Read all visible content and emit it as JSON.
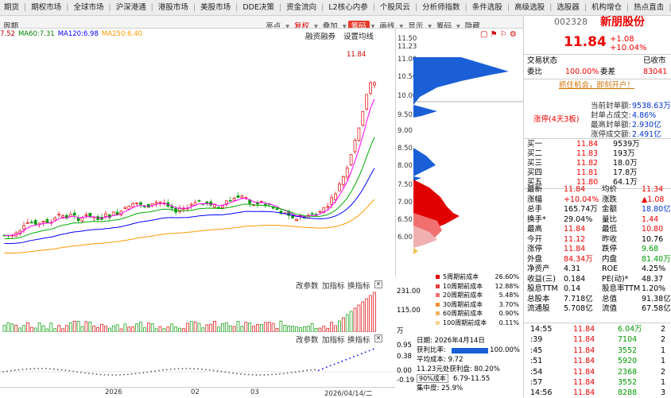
{
  "menubar": [
    "期货",
    "期权市场",
    "全球市场",
    "沪深港通",
    "港股市场",
    "美股市场",
    "DDE决策",
    "资金流向",
    "L2核心内参",
    "个股风云",
    "分析师指数",
    "条件选股",
    "高级选股",
    "选股器",
    "机构增仓",
    "热点直击",
    "高成长性"
  ],
  "toolbar": {
    "period": "周期",
    "tools": [
      "亮点",
      "复权",
      "叠加",
      "筹码",
      "画线",
      "显示",
      "筹码",
      "隐藏"
    ],
    "active": "筹码"
  },
  "ma_legend": [
    {
      "label": "7.52",
      "color": "#c00000"
    },
    {
      "label": "MA60:7.31",
      "color": "#008000"
    },
    {
      "label": "MA120:6.98",
      "color": "#0000ff"
    },
    {
      "label": "MA250:6.40",
      "color": "#ff9900"
    }
  ],
  "chart_tools": {
    "rzrq": "融资融券",
    "setma": "设置均线"
  },
  "price_marker": "11.84",
  "price_axis": [
    "11.50",
    "11.23",
    "11.00",
    "10.50",
    "10.00",
    "9.50",
    "9.00",
    "8.50",
    "8.00",
    "7.50",
    "7.00",
    "6.50",
    "6.00"
  ],
  "cost_legend": [
    {
      "label": "5周期前成本",
      "pct": "26.60%",
      "color": "#e00000"
    },
    {
      "label": "10周期前成本",
      "pct": "12.88%",
      "color": "#e84040"
    },
    {
      "label": "20周期前成本",
      "pct": "5.48%",
      "color": "#f07070"
    },
    {
      "label": "30周期前成本",
      "pct": "3.70%",
      "color": "#f09030"
    },
    {
      "label": "60周期前成本",
      "pct": "0.90%",
      "color": "#f0b060"
    },
    {
      "label": "100周期前成本",
      "pct": "0.11%",
      "color": "#f8d090"
    }
  ],
  "sub1": {
    "tools": [
      "改参数",
      "加指标",
      "换指标"
    ],
    "axis": [
      "231.00",
      "115.00",
      "万"
    ]
  },
  "sub2": {
    "tools": [
      "改参数",
      "加指标",
      "换指标"
    ],
    "axis": [
      "0.95",
      "0.38",
      "0.00",
      "-0.19"
    ]
  },
  "dates": [
    "2026",
    "02",
    "03",
    "2026/04/14/二"
  ],
  "cost_info": {
    "date": "日期: 2026年4月14日",
    "profit_label": "获利比率:",
    "profit": "100.00%",
    "avg": "平均成本: 9.72",
    "ratio": "11.23元处获利盘: 80.20%",
    "range_sel": "90%成本",
    "range": "6.79-11.55",
    "concentration": "集中度: 25.9%"
  },
  "stock": {
    "code": "002328",
    "name": "新朋股份",
    "price": "11.84",
    "change": "+1.08",
    "pct": "+10.04%"
  },
  "status": {
    "trade_label": "交易状态",
    "trade_val": "已收市",
    "weibi_label": "委比",
    "weibi": "100.00%",
    "weicha_label": "委差",
    "weicha": "83041",
    "ad": "抓住机会，即刻开户！"
  },
  "limit": {
    "tag": "涨停(4天3板)",
    "rows": [
      {
        "k": "当前封单额:",
        "v": "9538.63万"
      },
      {
        "k": "封单占成交:",
        "v": "4.86%"
      },
      {
        "k": "最高封单额:",
        "v": "2.930亿"
      },
      {
        "k": "涨停成交额:",
        "v": "2.491亿"
      }
    ]
  },
  "bids": [
    {
      "k": "买一",
      "p": "11.84",
      "v": "9539万"
    },
    {
      "k": "买二",
      "p": "11.83",
      "v": "193万"
    },
    {
      "k": "买三",
      "p": "11.82",
      "v": "18.0万"
    },
    {
      "k": "买四",
      "p": "11.81",
      "v": "17.8万"
    },
    {
      "k": "买五",
      "p": "11.80",
      "v": "64.1万"
    }
  ],
  "quote": [
    {
      "k1": "最新",
      "v1": "11.84",
      "c1": "red",
      "k2": "均价",
      "v2": "11.34",
      "c2": "red"
    },
    {
      "k1": "涨幅",
      "v1": "+10.04%",
      "c1": "red",
      "k2": "涨跌",
      "v2": "▲1.08",
      "c2": "red"
    },
    {
      "k1": "总手",
      "v1": "165.74万",
      "c1": "",
      "k2": "金额",
      "v2": "18.80亿",
      "c2": "blue"
    },
    {
      "k1": "换手*",
      "v1": "29.04%",
      "c1": "",
      "k2": "量比",
      "v2": "1.44",
      "c2": "red"
    },
    {
      "k1": "最高",
      "v1": "11.84",
      "c1": "red",
      "k2": "最低",
      "v2": "10.80",
      "c2": "red"
    },
    {
      "k1": "今开",
      "v1": "11.12",
      "c1": "red",
      "k2": "昨收",
      "v2": "10.76",
      "c2": ""
    },
    {
      "k1": "涨停",
      "v1": "11.84",
      "c1": "red",
      "k2": "跌停",
      "v2": "9.68",
      "c2": "green"
    },
    {
      "k1": "外盘",
      "v1": "84.34万",
      "c1": "red",
      "k2": "内盘",
      "v2": "81.40万",
      "c2": "green"
    },
    {
      "k1": "净资产",
      "v1": "4.31",
      "c1": "",
      "k2": "ROE",
      "v2": "4.25%",
      "c2": ""
    },
    {
      "k1": "收益(三)",
      "v1": "0.184",
      "c1": "",
      "k2": "PE(动)*",
      "v2": "48.37",
      "c2": ""
    },
    {
      "k1": "股息TTM",
      "v1": "0.14",
      "c1": "",
      "k2": "股息率TTM",
      "v2": "1.20%",
      "c2": ""
    },
    {
      "k1": "总股本",
      "v1": "7.718亿",
      "c1": "",
      "k2": "总值",
      "v2": "91.38亿",
      "c2": ""
    },
    {
      "k1": "流通股",
      "v1": "5.708亿",
      "c1": "",
      "k2": "流值",
      "v2": "67.58亿",
      "c2": ""
    }
  ],
  "ticks": [
    {
      "t": "14:55",
      "p": "11.84",
      "v": "6.04万",
      "n": "2"
    },
    {
      "t": ":39",
      "p": "11.84",
      "v": "7104",
      "n": "2"
    },
    {
      "t": ":45",
      "p": "11.84",
      "v": "3552",
      "n": "1"
    },
    {
      "t": ":51",
      "p": "11.84",
      "v": "5920",
      "n": "1"
    },
    {
      "t": ":54",
      "p": "11.84",
      "v": "2368",
      "n": "2"
    },
    {
      "t": ":57",
      "p": "11.84",
      "v": "3552",
      "n": "1"
    },
    {
      "t": "14:56",
      "p": "11.84",
      "v": "8288",
      "n": "3"
    }
  ]
}
